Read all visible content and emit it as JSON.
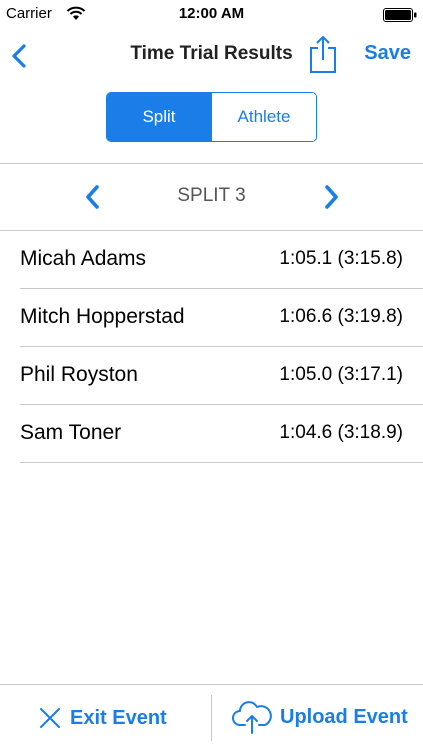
{
  "status_bar": {
    "carrier": "Carrier",
    "time": "12:00 AM",
    "wifi_icon": "wifi-icon",
    "battery_icon": "battery-icon"
  },
  "nav": {
    "title": "Time Trial Results",
    "save_label": "Save",
    "back_icon": "chevron-left-icon",
    "share_icon": "share-icon"
  },
  "segments": [
    {
      "label": "Split",
      "selected": true
    },
    {
      "label": "Athlete",
      "selected": false
    }
  ],
  "split_nav": {
    "label": "SPLIT 3",
    "prev_icon": "chevron-left-icon",
    "next_icon": "chevron-right-icon"
  },
  "results": [
    {
      "name": "Micah Adams",
      "time": "1:05.1 (3:15.8)"
    },
    {
      "name": "Mitch Hopperstad",
      "time": "1:06.6 (3:19.8)"
    },
    {
      "name": "Phil Royston",
      "time": "1:05.0 (3:17.1)"
    },
    {
      "name": "Sam Toner",
      "time": "1:04.6 (3:18.9)"
    }
  ],
  "bottom_bar": {
    "exit_label": "Exit Event",
    "upload_label": "Upload Event",
    "exit_icon": "close-icon",
    "upload_icon": "cloud-upload-icon"
  },
  "colors": {
    "accent": "#1a7de8",
    "separator": "#c8c7cc"
  }
}
